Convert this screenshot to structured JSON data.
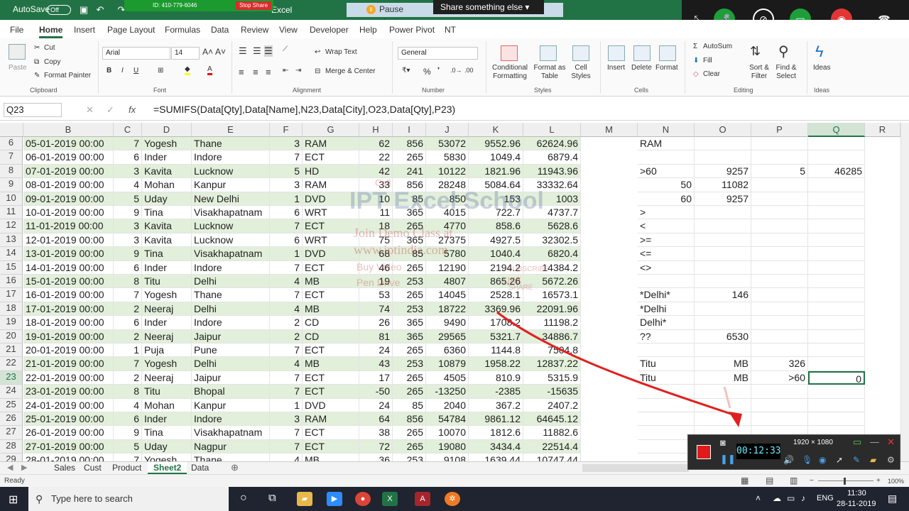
{
  "titlebar": {
    "autosave_label": "AutoSave",
    "autosave_state": "Off",
    "app_label": "Excel",
    "zoom_id": "ID: 410-779-6046",
    "stop_share": "Stop Share"
  },
  "share_bar": {
    "pause_label": "Pause sharing",
    "share_other_label": "Share something else"
  },
  "ribbon_tabs": [
    "File",
    "Home",
    "Insert",
    "Page Layout",
    "Formulas",
    "Data",
    "Review",
    "View",
    "Developer",
    "Help",
    "Power Pivot",
    "NT"
  ],
  "ribbon": {
    "paste": "Paste",
    "cut": "Cut",
    "copy": "Copy",
    "format_painter": "Format Painter",
    "clipboard": "Clipboard",
    "font_name": "Arial",
    "font_size": "14",
    "font_group": "Font",
    "wrap_text": "Wrap Text",
    "merge_center": "Merge & Center",
    "alignment_group": "Alignment",
    "number_format": "General",
    "number_group": "Number",
    "conditional_formatting": "Conditional Formatting",
    "format_as_table": "Format as Table",
    "cell_styles": "Cell Styles",
    "styles_group": "Styles",
    "insert": "Insert",
    "delete": "Delete",
    "format": "Format",
    "cells_group": "Cells",
    "autosum": "AutoSum",
    "fill": "Fill",
    "clear": "Clear",
    "sort_filter": "Sort & Filter",
    "find_select": "Find & Select",
    "editing_group": "Editing",
    "ideas": "Ideas",
    "ideas_group": "Ideas"
  },
  "formula_bar": {
    "name_box": "Q23",
    "fx": "fx",
    "formula": "=SUMIFS(Data[Qty],Data[Name],N23,Data[City],O23,Data[Qty],P23)"
  },
  "columns": [
    "B",
    "C",
    "D",
    "E",
    "F",
    "G",
    "H",
    "I",
    "J",
    "K",
    "L",
    "M",
    "N",
    "O",
    "P",
    "Q",
    "R"
  ],
  "rows": [
    {
      "n": "6",
      "B": "05-01-2019 00:00",
      "C": "7",
      "D": "Yogesh",
      "E": "Thane",
      "F": "3",
      "G": "RAM",
      "H": "62",
      "I": "856",
      "J": "53072",
      "K": "9552.96",
      "L": "62624.96",
      "N": "RAM",
      "O": "",
      "P": "",
      "Q": ""
    },
    {
      "n": "7",
      "B": "06-01-2019 00:00",
      "C": "6",
      "D": "Inder",
      "E": "Indore",
      "F": "7",
      "G": "ECT",
      "H": "22",
      "I": "265",
      "J": "5830",
      "K": "1049.4",
      "L": "6879.4",
      "N": "",
      "O": "",
      "P": "",
      "Q": ""
    },
    {
      "n": "8",
      "B": "07-01-2019 00:00",
      "C": "3",
      "D": "Kavita",
      "E": "Lucknow",
      "F": "5",
      "G": "HD",
      "H": "42",
      "I": "241",
      "J": "10122",
      "K": "1821.96",
      "L": "11943.96",
      "N": ">60",
      "O": "9257",
      "P": "5",
      "Q": "46285"
    },
    {
      "n": "9",
      "B": "08-01-2019 00:00",
      "C": "4",
      "D": "Mohan",
      "E": "Kanpur",
      "F": "3",
      "G": "RAM",
      "H": "33",
      "I": "856",
      "J": "28248",
      "K": "5084.64",
      "L": "33332.64",
      "N": "50",
      "O": "11082",
      "P": "",
      "Q": ""
    },
    {
      "n": "10",
      "B": "09-01-2019 00:00",
      "C": "5",
      "D": "Uday",
      "E": "New Delhi",
      "F": "1",
      "G": "DVD",
      "H": "10",
      "I": "85",
      "J": "850",
      "K": "153",
      "L": "1003",
      "N": "60",
      "O": "9257",
      "P": "",
      "Q": ""
    },
    {
      "n": "11",
      "B": "10-01-2019 00:00",
      "C": "9",
      "D": "Tina",
      "E": "Visakhapatnam",
      "F": "6",
      "G": "WRT",
      "H": "11",
      "I": "365",
      "J": "4015",
      "K": "722.7",
      "L": "4737.7",
      "N": ">",
      "O": "",
      "P": "",
      "Q": ""
    },
    {
      "n": "12",
      "B": "11-01-2019 00:00",
      "C": "3",
      "D": "Kavita",
      "E": "Lucknow",
      "F": "7",
      "G": "ECT",
      "H": "18",
      "I": "265",
      "J": "4770",
      "K": "858.6",
      "L": "5628.6",
      "N": "<",
      "O": "",
      "P": "",
      "Q": ""
    },
    {
      "n": "13",
      "B": "12-01-2019 00:00",
      "C": "3",
      "D": "Kavita",
      "E": "Lucknow",
      "F": "6",
      "G": "WRT",
      "H": "75",
      "I": "365",
      "J": "27375",
      "K": "4927.5",
      "L": "32302.5",
      "N": ">=",
      "O": "",
      "P": "",
      "Q": ""
    },
    {
      "n": "14",
      "B": "13-01-2019 00:00",
      "C": "9",
      "D": "Tina",
      "E": "Visakhapatnam",
      "F": "1",
      "G": "DVD",
      "H": "68",
      "I": "85",
      "J": "5780",
      "K": "1040.4",
      "L": "6820.4",
      "N": "<=",
      "O": "",
      "P": "",
      "Q": ""
    },
    {
      "n": "15",
      "B": "14-01-2019 00:00",
      "C": "6",
      "D": "Inder",
      "E": "Indore",
      "F": "7",
      "G": "ECT",
      "H": "46",
      "I": "265",
      "J": "12190",
      "K": "2194.2",
      "L": "14384.2",
      "N": "<>",
      "O": "",
      "P": "",
      "Q": ""
    },
    {
      "n": "16",
      "B": "15-01-2019 00:00",
      "C": "8",
      "D": "Titu",
      "E": "Delhi",
      "F": "4",
      "G": "MB",
      "H": "19",
      "I": "253",
      "J": "4807",
      "K": "865.26",
      "L": "5672.26",
      "N": "",
      "O": "",
      "P": "",
      "Q": ""
    },
    {
      "n": "17",
      "B": "16-01-2019 00:00",
      "C": "7",
      "D": "Yogesh",
      "E": "Thane",
      "F": "7",
      "G": "ECT",
      "H": "53",
      "I": "265",
      "J": "14045",
      "K": "2528.1",
      "L": "16573.1",
      "N": "*Delhi*",
      "O": "146",
      "P": "",
      "Q": ""
    },
    {
      "n": "18",
      "B": "17-01-2019 00:00",
      "C": "2",
      "D": "Neeraj",
      "E": "Delhi",
      "F": "4",
      "G": "MB",
      "H": "74",
      "I": "253",
      "J": "18722",
      "K": "3369.96",
      "L": "22091.96",
      "N": "*Delhi",
      "O": "",
      "P": "",
      "Q": ""
    },
    {
      "n": "19",
      "B": "18-01-2019 00:00",
      "C": "6",
      "D": "Inder",
      "E": "Indore",
      "F": "2",
      "G": "CD",
      "H": "26",
      "I": "365",
      "J": "9490",
      "K": "1708.2",
      "L": "11198.2",
      "N": "Delhi*",
      "O": "",
      "P": "",
      "Q": ""
    },
    {
      "n": "20",
      "B": "19-01-2019 00:00",
      "C": "2",
      "D": "Neeraj",
      "E": "Jaipur",
      "F": "2",
      "G": "CD",
      "H": "81",
      "I": "365",
      "J": "29565",
      "K": "5321.7",
      "L": "34886.7",
      "N": "??",
      "O": "6530",
      "P": "",
      "Q": ""
    },
    {
      "n": "21",
      "B": "20-01-2019 00:00",
      "C": "1",
      "D": "Puja",
      "E": "Pune",
      "F": "7",
      "G": "ECT",
      "H": "24",
      "I": "265",
      "J": "6360",
      "K": "1144.8",
      "L": "7504.8",
      "N": "",
      "O": "",
      "P": "",
      "Q": ""
    },
    {
      "n": "22",
      "B": "21-01-2019 00:00",
      "C": "7",
      "D": "Yogesh",
      "E": "Delhi",
      "F": "4",
      "G": "MB",
      "H": "43",
      "I": "253",
      "J": "10879",
      "K": "1958.22",
      "L": "12837.22",
      "N": "Titu",
      "O": "MB",
      "P": "326",
      "Q": ""
    },
    {
      "n": "23",
      "B": "22-01-2019 00:00",
      "C": "2",
      "D": "Neeraj",
      "E": "Jaipur",
      "F": "7",
      "G": "ECT",
      "H": "17",
      "I": "265",
      "J": "4505",
      "K": "810.9",
      "L": "5315.9",
      "N": "Titu",
      "O": "MB",
      "P": ">60",
      "Q": "0"
    },
    {
      "n": "24",
      "B": "23-01-2019 00:00",
      "C": "8",
      "D": "Titu",
      "E": "Bhopal",
      "F": "7",
      "G": "ECT",
      "H": "-50",
      "I": "265",
      "J": "-13250",
      "K": "-2385",
      "L": "-15635",
      "N": "",
      "O": "",
      "P": "",
      "Q": ""
    },
    {
      "n": "25",
      "B": "24-01-2019 00:00",
      "C": "4",
      "D": "Mohan",
      "E": "Kanpur",
      "F": "1",
      "G": "DVD",
      "H": "24",
      "I": "85",
      "J": "2040",
      "K": "367.2",
      "L": "2407.2",
      "N": "",
      "O": "",
      "P": "",
      "Q": ""
    },
    {
      "n": "26",
      "B": "25-01-2019 00:00",
      "C": "6",
      "D": "Inder",
      "E": "Indore",
      "F": "3",
      "G": "RAM",
      "H": "64",
      "I": "856",
      "J": "54784",
      "K": "9861.12",
      "L": "64645.12",
      "N": "",
      "O": "",
      "P": "",
      "Q": ""
    },
    {
      "n": "27",
      "B": "26-01-2019 00:00",
      "C": "9",
      "D": "Tina",
      "E": "Visakhapatnam",
      "F": "7",
      "G": "ECT",
      "H": "38",
      "I": "265",
      "J": "10070",
      "K": "1812.6",
      "L": "11882.6",
      "N": "",
      "O": "",
      "P": "",
      "Q": ""
    },
    {
      "n": "28",
      "B": "27-01-2019 00:00",
      "C": "5",
      "D": "Uday",
      "E": "Nagpur",
      "F": "7",
      "G": "ECT",
      "H": "72",
      "I": "265",
      "J": "19080",
      "K": "3434.4",
      "L": "22514.4",
      "N": "",
      "O": "",
      "P": "",
      "Q": ""
    },
    {
      "n": "29",
      "B": "28-01-2019 00:00",
      "C": "7",
      "D": "Yogesh",
      "E": "Thane",
      "F": "4",
      "G": "MB",
      "H": "36",
      "I": "253",
      "J": "9108",
      "K": "1639.44",
      "L": "10747.44",
      "N": "",
      "O": "",
      "P": "",
      "Q": ""
    }
  ],
  "sheet_tabs": [
    "Sales",
    "Cust",
    "Product",
    "Sheet2",
    "Data"
  ],
  "active_sheet": "Sheet2",
  "status": {
    "ready": "Ready",
    "zoom": "100%"
  },
  "recorder": {
    "resolution": "1920 × 1080",
    "timer": "00:12:33"
  },
  "watermark": {
    "brand": "IPT Excel School",
    "line1": "Join Demo Class at",
    "line2": "www.iptindia.com",
    "line3": "Buy Video",
    "line4": "Pen Drive",
    "subscribe": "SUBSCRIBE",
    "like": "LIKE",
    "share": "SHARE",
    "call": "Call"
  },
  "taskbar": {
    "search_placeholder": "Type here to search",
    "lang": "ENG",
    "time": "11:30",
    "date": "28-11-2019"
  },
  "colors": {
    "excel_green": "#217346",
    "band": "#e2efda",
    "taskbar": "#1f2430"
  }
}
